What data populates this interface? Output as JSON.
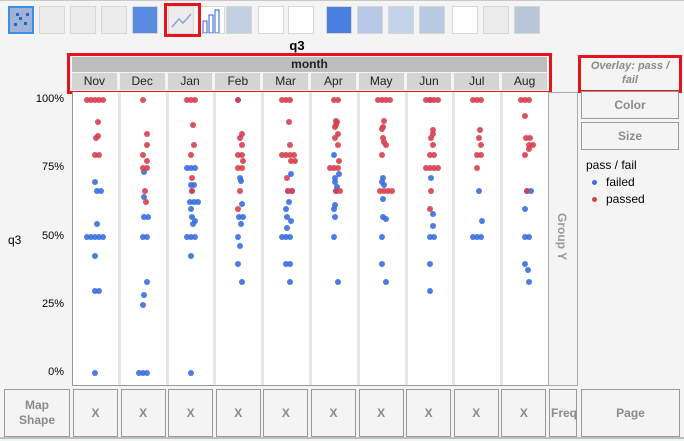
{
  "toolbar": {
    "icons": [
      "points-icon",
      "smoother-icon",
      "line-of-fit-icon",
      "ellipse-icon",
      "contour-icon",
      "line-icon",
      "bar-icon",
      "area-icon",
      "box-plot-icon",
      "histogram-icon",
      "heatmap-icon",
      "pie-icon",
      "treemap-icon",
      "mosaic-icon",
      "caption-box-icon",
      "formula-icon",
      "map-shapes-icon"
    ],
    "selected": "points-icon",
    "highlighted": "line-icon"
  },
  "title": "q3",
  "header": {
    "group_label": "month",
    "months": [
      "Nov",
      "Dec",
      "Jan",
      "Feb",
      "Mar",
      "Apr",
      "May",
      "Jun",
      "Jul",
      "Aug"
    ]
  },
  "overlay_label": "Overlay: pass / fail",
  "y_axis": {
    "label": "q3",
    "ticks": [
      "100%",
      "75%",
      "50%",
      "25%",
      "0%"
    ]
  },
  "group_y_label": "Group Y",
  "color_button": "Color",
  "size_button": "Size",
  "legend": {
    "title": "pass / fail",
    "items": [
      {
        "label": "failed",
        "color": "#3a6fe0"
      },
      {
        "label": "passed",
        "color": "#d8404f"
      }
    ]
  },
  "bottom": {
    "map_shape": "Map Shape",
    "x_label": "X",
    "freq": "Freq",
    "page": "Page"
  },
  "chart_data": {
    "type": "scatter",
    "title": "q3",
    "ylabel": "q3",
    "xlabel": "month",
    "ylim": [
      0,
      100
    ],
    "categories": [
      "Nov",
      "Dec",
      "Jan",
      "Feb",
      "Mar",
      "Apr",
      "May",
      "Jun",
      "Jul",
      "Aug"
    ],
    "series": [
      {
        "name": "failed",
        "color": "#3a6fe0",
        "values": [
          [
            70,
            66.7,
            66.7,
            54.6,
            50,
            50,
            50,
            50,
            50,
            42.9,
            30,
            30,
            0
          ],
          [
            73.8,
            64.4,
            57.3,
            57.3,
            50,
            50,
            33.4,
            28.7,
            25,
            0,
            0,
            0
          ],
          [
            75,
            75,
            75,
            69,
            68.7,
            66.7,
            62.6,
            62.6,
            62.6,
            60,
            57.3,
            55.7,
            54.6,
            50,
            50,
            50,
            42.9,
            0
          ],
          [
            100,
            71.6,
            70.4,
            62,
            57.3,
            57.3,
            54.6,
            50,
            46.7,
            40,
            33.4
          ],
          [
            72.8,
            66.7,
            66.7,
            62.6,
            60,
            57.3,
            55.7,
            53,
            50,
            50,
            50,
            40,
            40,
            33.4
          ],
          [
            80,
            72.8,
            71.6,
            70.1,
            68.3,
            66.7,
            61.6,
            60,
            57.3,
            50,
            33.4
          ],
          [
            71.6,
            70.1,
            68.9,
            63.8,
            57.3,
            56.3,
            50,
            40,
            33.4
          ],
          [
            100,
            71.6,
            58.4,
            54,
            50,
            50,
            40,
            30.1
          ],
          [
            66.7,
            55.7,
            50,
            50,
            50
          ],
          [
            66.7,
            66.7,
            60,
            50,
            50,
            40,
            37.6,
            33.4
          ]
        ]
      },
      {
        "name": "passed",
        "color": "#d8404f",
        "values": [
          [
            100,
            100,
            100,
            100,
            100,
            91.8,
            86.8,
            85.9,
            80,
            80
          ],
          [
            100,
            87.7,
            83.4,
            80,
            77.8,
            75,
            75,
            66.7,
            62.6
          ],
          [
            100,
            100,
            100,
            91,
            83.4,
            80,
            71.6,
            66.7
          ],
          [
            100,
            87.7,
            85.9,
            83.4,
            80,
            80,
            77.8,
            75,
            75,
            66.7,
            60
          ],
          [
            100,
            100,
            100,
            91.8,
            83.4,
            80,
            80,
            80,
            80,
            77.8,
            77.8,
            71.6,
            66.7,
            66.7
          ],
          [
            100,
            100,
            92.4,
            91.8,
            91,
            90.2,
            87.7,
            85.9,
            83.4,
            77.8,
            75,
            75,
            75,
            66.7,
            66.7
          ],
          [
            100,
            100,
            100,
            100,
            92.4,
            90.2,
            89.3,
            85.9,
            84.6,
            83.4,
            80,
            66.7,
            66.7,
            66.7,
            66.7
          ],
          [
            100,
            100,
            100,
            100,
            89,
            87.7,
            85.9,
            83.4,
            80,
            80,
            75,
            75,
            75,
            75,
            66.7,
            60
          ],
          [
            100,
            100,
            100,
            89,
            85.9,
            83.4,
            80,
            80,
            75
          ],
          [
            100,
            100,
            100,
            94.3,
            85.9,
            85.9,
            83.4,
            83.4,
            82,
            80,
            66.7
          ]
        ]
      }
    ]
  }
}
